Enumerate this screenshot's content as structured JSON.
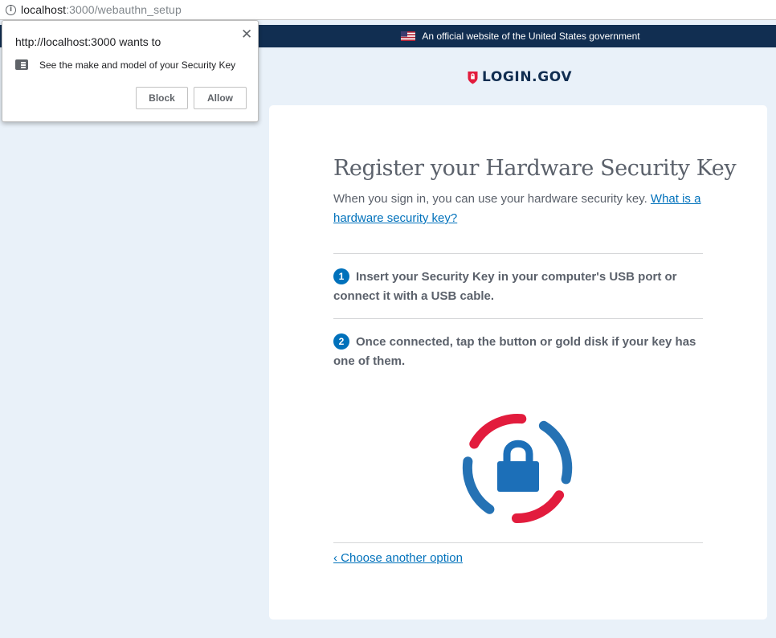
{
  "browser": {
    "url_host": "localhost",
    "url_path": ":3000/webauthn_setup"
  },
  "banner": {
    "text": "An official website of the United States government"
  },
  "logo": {
    "text": "LOGIN.GOV"
  },
  "page": {
    "title": "Register your Hardware Security Key",
    "intro_text": "When you sign in, you can use your hardware security key. ",
    "intro_link": "What is a hardware security key?",
    "steps": [
      {
        "number": "1",
        "text": "Insert your Security Key in your computer's USB port or connect it with a USB cable."
      },
      {
        "number": "2",
        "text": "Once connected, tap the button or gold disk if your key has one of them."
      }
    ],
    "back_link": "‹ Choose another option"
  },
  "permission_popup": {
    "heading": "http://localhost:3000 wants to",
    "detail": "See the make and model of your Security Key",
    "block_label": "Block",
    "allow_label": "Allow",
    "close_glyph": "✕"
  },
  "colors": {
    "banner_bg": "#112e51",
    "accent_blue": "#0071bb",
    "accent_red": "#e21c3d",
    "page_bg": "#e9f1f9",
    "text_gray": "#5b616b"
  }
}
